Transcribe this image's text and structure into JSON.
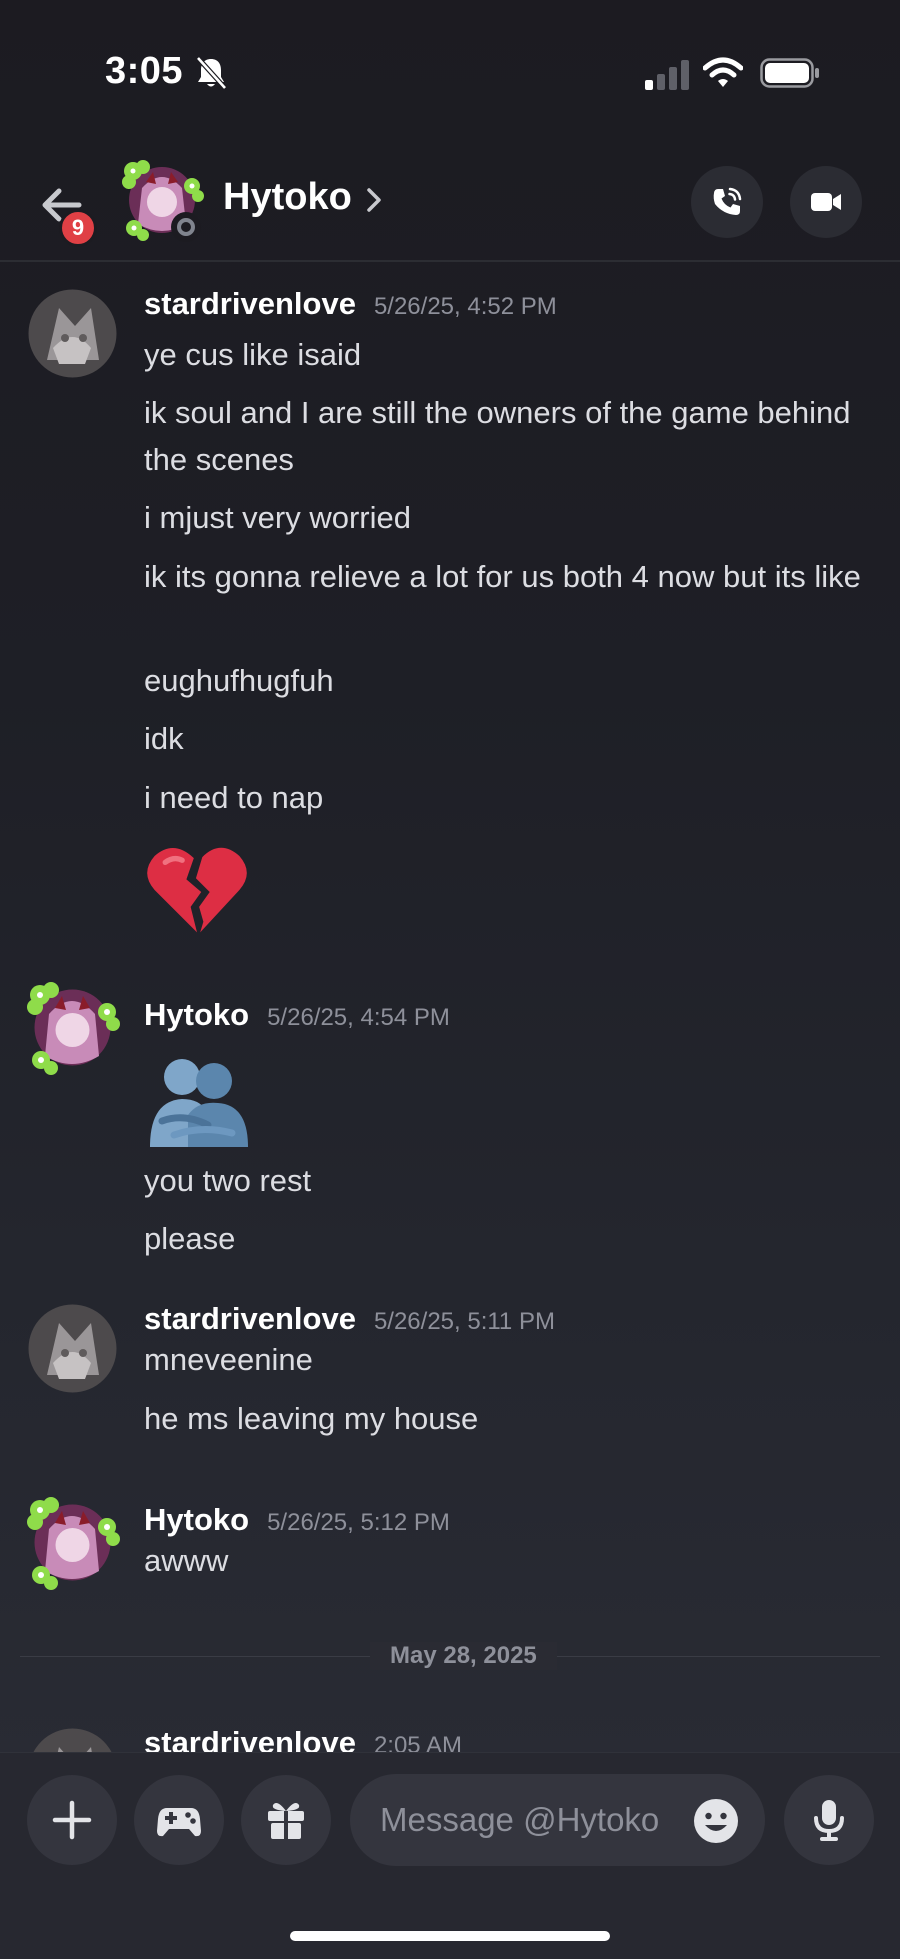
{
  "status_bar": {
    "time": "3:05"
  },
  "header": {
    "back_badge": "9",
    "name": "Hytoko"
  },
  "messages": [
    {
      "author": "stardrivenlove",
      "timestamp": "5/26/25, 4:52 PM",
      "lines": [
        "ye cus like isaid",
        "ik soul and I are still the owners of the game behind the scenes",
        "i mjust very worried",
        "ik its gonna relieve a lot for us both 4 now but its like",
        "eughufhugfuh",
        "idk",
        "i need to nap"
      ],
      "emoji": "broken-heart"
    },
    {
      "author": "Hytoko",
      "timestamp": "5/26/25, 4:54 PM",
      "emoji": "people-hugging",
      "lines": [
        "you two rest",
        "please"
      ]
    },
    {
      "author": "stardrivenlove",
      "timestamp": "5/26/25, 5:11 PM",
      "lines": [
        "mneveenine",
        "he ms leaving my house"
      ]
    },
    {
      "author": "Hytoko",
      "timestamp": "5/26/25, 5:12 PM",
      "lines": [
        "awww"
      ]
    },
    {
      "author": "stardrivenlove",
      "timestamp": "2:05 AM",
      "lines": []
    }
  ],
  "date_divider": "May 28, 2025",
  "composer": {
    "placeholder": "Message @Hytoko"
  },
  "colors": {
    "background": "#1e1f26",
    "badge": "#e04045",
    "text": "#dcdde2",
    "muted": "#8e909a"
  }
}
